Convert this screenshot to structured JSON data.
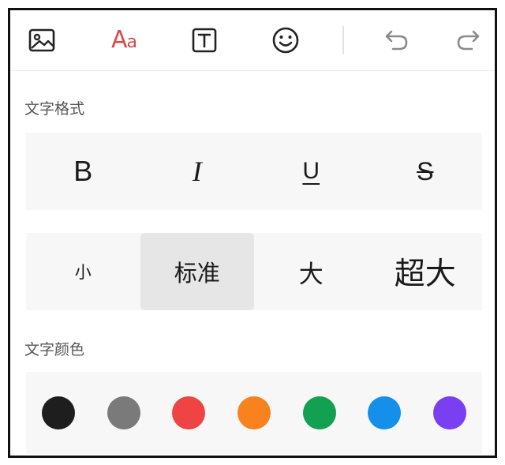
{
  "toolbar": {
    "items": [
      {
        "name": "image-icon"
      },
      {
        "name": "text-style-icon",
        "label": "Aa",
        "color": "#d84a4a"
      },
      {
        "name": "text-box-icon"
      },
      {
        "name": "emoji-icon"
      },
      {
        "name": "undo-icon"
      },
      {
        "name": "redo-icon"
      }
    ]
  },
  "text_format": {
    "label": "文字格式",
    "buttons": [
      {
        "name": "bold",
        "glyph": "B"
      },
      {
        "name": "italic",
        "glyph": "I"
      },
      {
        "name": "underline",
        "glyph": "U"
      },
      {
        "name": "strikethrough",
        "glyph": "S"
      }
    ]
  },
  "text_size": {
    "options": [
      "小",
      "标准",
      "大",
      "超大"
    ],
    "selected": "标准"
  },
  "text_color": {
    "label": "文字颜色",
    "swatches": [
      "#1e1e1e",
      "#7a7a7a",
      "#ee4444",
      "#f7821e",
      "#12a150",
      "#1590ea",
      "#7b3ff2"
    ]
  }
}
